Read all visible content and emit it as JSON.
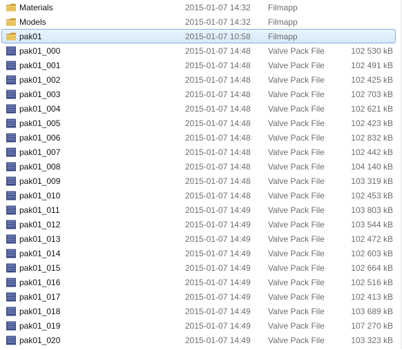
{
  "files": [
    {
      "name": "Materials",
      "date": "2015-01-07 14:32",
      "type": "Filmapp",
      "size": "",
      "kind": "folder",
      "icon": "folder-icon"
    },
    {
      "name": "Models",
      "date": "2015-01-07 14:32",
      "type": "Filmapp",
      "size": "",
      "kind": "folder",
      "icon": "folder-icon"
    },
    {
      "name": "pak01",
      "date": "2015-01-07 10:58",
      "type": "Filmapp",
      "size": "",
      "kind": "folder",
      "icon": "folder-icon",
      "selected": true
    },
    {
      "name": "pak01_000",
      "date": "2015-01-07 14:48",
      "type": "Valve Pack File",
      "size": "102 530 kB",
      "kind": "file",
      "icon": "vpk-file-icon"
    },
    {
      "name": "pak01_001",
      "date": "2015-01-07 14:48",
      "type": "Valve Pack File",
      "size": "102 491 kB",
      "kind": "file",
      "icon": "vpk-file-icon"
    },
    {
      "name": "pak01_002",
      "date": "2015-01-07 14:48",
      "type": "Valve Pack File",
      "size": "102 425 kB",
      "kind": "file",
      "icon": "vpk-file-icon"
    },
    {
      "name": "pak01_003",
      "date": "2015-01-07 14:48",
      "type": "Valve Pack File",
      "size": "102 703 kB",
      "kind": "file",
      "icon": "vpk-file-icon"
    },
    {
      "name": "pak01_004",
      "date": "2015-01-07 14:48",
      "type": "Valve Pack File",
      "size": "102 621 kB",
      "kind": "file",
      "icon": "vpk-file-icon"
    },
    {
      "name": "pak01_005",
      "date": "2015-01-07 14:48",
      "type": "Valve Pack File",
      "size": "102 423 kB",
      "kind": "file",
      "icon": "vpk-file-icon"
    },
    {
      "name": "pak01_006",
      "date": "2015-01-07 14:48",
      "type": "Valve Pack File",
      "size": "102 832 kB",
      "kind": "file",
      "icon": "vpk-file-icon"
    },
    {
      "name": "pak01_007",
      "date": "2015-01-07 14:48",
      "type": "Valve Pack File",
      "size": "102 442 kB",
      "kind": "file",
      "icon": "vpk-file-icon"
    },
    {
      "name": "pak01_008",
      "date": "2015-01-07 14:48",
      "type": "Valve Pack File",
      "size": "104 140 kB",
      "kind": "file",
      "icon": "vpk-file-icon"
    },
    {
      "name": "pak01_009",
      "date": "2015-01-07 14:48",
      "type": "Valve Pack File",
      "size": "103 319 kB",
      "kind": "file",
      "icon": "vpk-file-icon"
    },
    {
      "name": "pak01_010",
      "date": "2015-01-07 14:48",
      "type": "Valve Pack File",
      "size": "102 453 kB",
      "kind": "file",
      "icon": "vpk-file-icon"
    },
    {
      "name": "pak01_011",
      "date": "2015-01-07 14:49",
      "type": "Valve Pack File",
      "size": "103 803 kB",
      "kind": "file",
      "icon": "vpk-file-icon"
    },
    {
      "name": "pak01_012",
      "date": "2015-01-07 14:49",
      "type": "Valve Pack File",
      "size": "103 544 kB",
      "kind": "file",
      "icon": "vpk-file-icon"
    },
    {
      "name": "pak01_013",
      "date": "2015-01-07 14:49",
      "type": "Valve Pack File",
      "size": "102 472 kB",
      "kind": "file",
      "icon": "vpk-file-icon"
    },
    {
      "name": "pak01_014",
      "date": "2015-01-07 14:49",
      "type": "Valve Pack File",
      "size": "102 603 kB",
      "kind": "file",
      "icon": "vpk-file-icon"
    },
    {
      "name": "pak01_015",
      "date": "2015-01-07 14:49",
      "type": "Valve Pack File",
      "size": "102 664 kB",
      "kind": "file",
      "icon": "vpk-file-icon"
    },
    {
      "name": "pak01_016",
      "date": "2015-01-07 14:49",
      "type": "Valve Pack File",
      "size": "102 516 kB",
      "kind": "file",
      "icon": "vpk-file-icon"
    },
    {
      "name": "pak01_017",
      "date": "2015-01-07 14:49",
      "type": "Valve Pack File",
      "size": "102 413 kB",
      "kind": "file",
      "icon": "vpk-file-icon"
    },
    {
      "name": "pak01_018",
      "date": "2015-01-07 14:49",
      "type": "Valve Pack File",
      "size": "103 689 kB",
      "kind": "file",
      "icon": "vpk-file-icon"
    },
    {
      "name": "pak01_019",
      "date": "2015-01-07 14:49",
      "type": "Valve Pack File",
      "size": "107 270 kB",
      "kind": "file",
      "icon": "vpk-file-icon"
    },
    {
      "name": "pak01_020",
      "date": "2015-01-07 14:49",
      "type": "Valve Pack File",
      "size": "103 323 kB",
      "kind": "file",
      "icon": "vpk-file-icon"
    }
  ],
  "colors": {
    "folder": "#e8c15a",
    "folder_dark": "#c99a2e",
    "file_icon": "#3f4f8a",
    "selection_border": "#84acdd"
  }
}
